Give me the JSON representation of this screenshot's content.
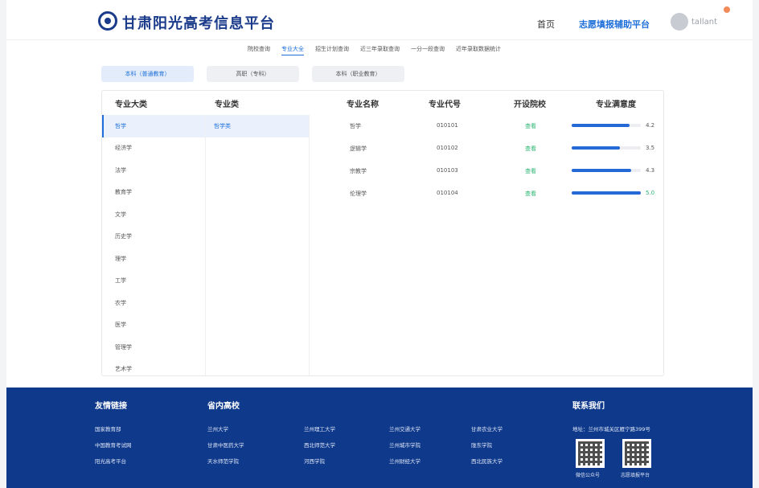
{
  "header": {
    "brand": "甘肃阳光高考信息平台",
    "nav_home": "首页",
    "nav_assist": "志愿填报辅助平台",
    "user_name": "tallant"
  },
  "subnav": [
    "院校查询",
    "专业大全",
    "招生计划查询",
    "近三年录取查询",
    "一分一段查询",
    "近年录取数据统计"
  ],
  "subnav_active": "专业大全",
  "tabs": [
    {
      "label": "本科（普通教育）",
      "active": true
    },
    {
      "label": "高职（专科）",
      "active": false
    },
    {
      "label": "本科（职业教育）",
      "active": false
    }
  ],
  "columns": {
    "category": "专业大类",
    "subcategory": "专业类",
    "name": "专业名称",
    "code": "专业代号",
    "schools": "开设院校",
    "satisfaction": "专业满意度"
  },
  "categories": [
    "哲学",
    "经济学",
    "法学",
    "教育学",
    "文学",
    "历史学",
    "理学",
    "工学",
    "农学",
    "医学",
    "管理学",
    "艺术学"
  ],
  "active_category": "哲学",
  "subcategories": [
    "哲学类"
  ],
  "majors": [
    {
      "name": "哲学",
      "code": "010101",
      "schools": "查看",
      "score": "4.2",
      "fraction": 0.84
    },
    {
      "name": "逻辑学",
      "code": "010102",
      "schools": "查看",
      "score": "3.5",
      "fraction": 0.7
    },
    {
      "name": "宗教学",
      "code": "010103",
      "schools": "查看",
      "score": "4.3",
      "fraction": 0.86
    },
    {
      "name": "伦理学",
      "code": "010104",
      "schools": "查看",
      "score": "5.0",
      "fraction": 1.0
    }
  ],
  "footer": {
    "friend_links_title": "友情链接",
    "friend_links": [
      "国家教育部",
      "中国教育考试网",
      "阳光高考平台"
    ],
    "schools_title": "省内高校",
    "schools": [
      [
        "兰州大学",
        "兰州理工大学",
        "兰州交通大学",
        "甘肃农业大学"
      ],
      [
        "甘肃中医药大学",
        "西北师范大学",
        "兰州城市学院",
        "陇东学院"
      ],
      [
        "天水师范学院",
        "河西学院",
        "兰州财经大学",
        "西北民族大学"
      ]
    ],
    "contact_title": "联系我们",
    "address": "地址：兰州市城关区雁宁路399号",
    "qr_captions": [
      "微信公众号",
      "志愿填报平台"
    ]
  }
}
